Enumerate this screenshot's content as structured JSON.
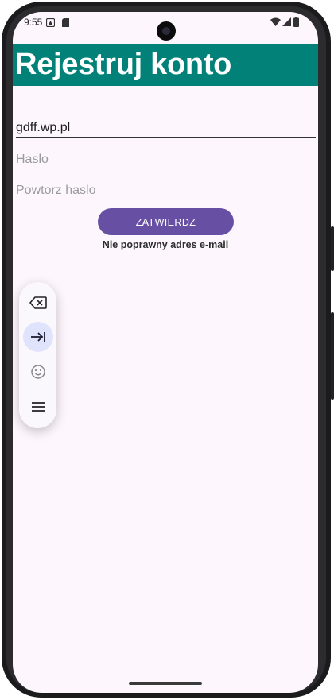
{
  "status": {
    "time": "9:55"
  },
  "appbar": {
    "title": "Rejestruj konto"
  },
  "form": {
    "email": {
      "value": "gdff.wp.pl"
    },
    "password": {
      "placeholder": "Haslo"
    },
    "repeat_password": {
      "placeholder": "Powtorz haslo"
    },
    "submit_label": "ZATWIERDZ",
    "error": "Nie poprawny adres e-mail"
  },
  "floating_toolbar": {
    "items": [
      {
        "icon": "backspace-icon"
      },
      {
        "icon": "tab-icon",
        "active": true
      },
      {
        "icon": "emoji-icon"
      },
      {
        "icon": "menu-icon"
      }
    ]
  },
  "colors": {
    "appbar": "#028178",
    "button": "#6750a4",
    "background": "#fdf6fc"
  }
}
